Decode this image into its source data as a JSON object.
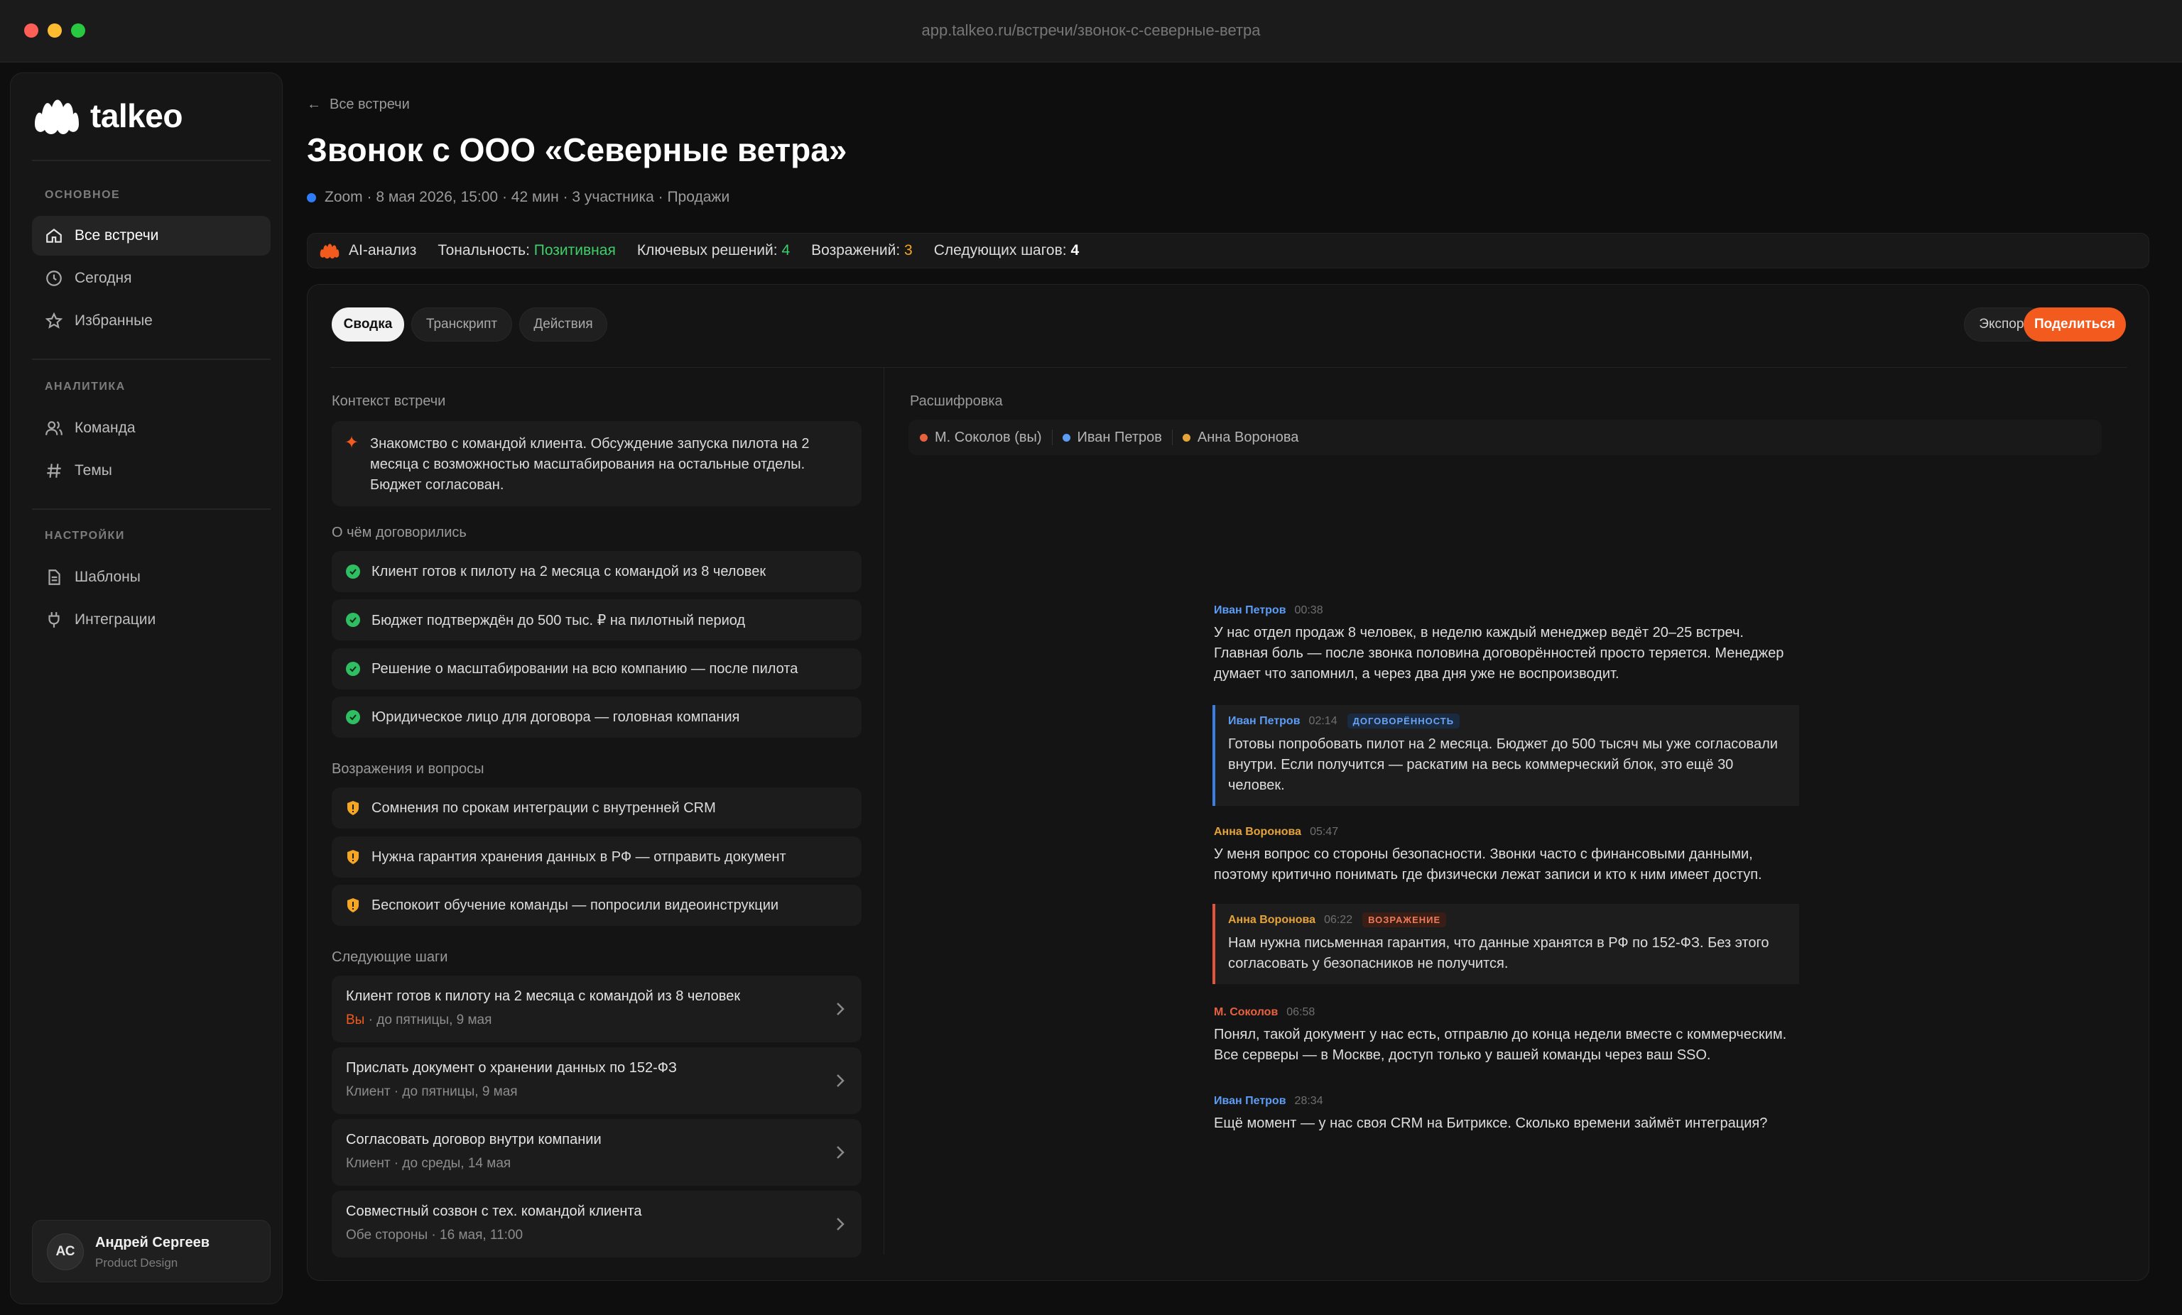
{
  "browser": {
    "url": "app.talkeo.ru/встречи/звонок-с-северные-ветра"
  },
  "brand": {
    "name": "talkeo",
    "accent": "#f35a1e"
  },
  "sidebar": {
    "sections": [
      {
        "label": "ОСНОВНОЕ",
        "items": [
          {
            "label": "Все встречи",
            "icon": "home-icon",
            "active": true
          },
          {
            "label": "Сегодня",
            "icon": "clock-icon"
          },
          {
            "label": "Избранные",
            "icon": "star-icon"
          }
        ]
      },
      {
        "label": "АНАЛИТИКА",
        "items": [
          {
            "label": "Команда",
            "icon": "users-icon"
          },
          {
            "label": "Темы",
            "icon": "hash-icon"
          }
        ]
      },
      {
        "label": "НАСТРОЙКИ",
        "items": [
          {
            "label": "Шаблоны",
            "icon": "document-icon"
          },
          {
            "label": "Интеграции",
            "icon": "plug-icon"
          }
        ]
      }
    ],
    "user": {
      "initials": "АС",
      "name": "Андрей Сергеев",
      "role": "Product Design"
    }
  },
  "header": {
    "back": "Все встречи",
    "title": "Звонок с ООО «Северные ветра»",
    "meta": "Zoom · 8 мая 2026, 15:00 · 42 мин · 3 участника · Продажи"
  },
  "ai_bar": {
    "label": "AI-анализ",
    "tone_label": "Тональность:",
    "tone_value": "Позитивная",
    "decisions_label": "Ключевых решений:",
    "decisions_value": "4",
    "objections_label": "Возражений:",
    "objections_value": "3",
    "steps_label": "Следующих шагов:",
    "steps_value": "4"
  },
  "tabs": [
    "Сводка",
    "Транскрипт",
    "Действия"
  ],
  "actions": {
    "export": "Экспорт",
    "share": "Поделиться"
  },
  "summary": {
    "context_title": "Контекст встречи",
    "context_text": "Знакомство с командой клиента. Обсуждение запуска пилота на 2 месяца с возможностью масштабирования на остальные отделы. Бюджет согласован.",
    "agreed_title": "О чём договорились",
    "agreed": [
      "Клиент готов к пилоту на 2 месяца с командой из 8 человек",
      "Бюджет подтверждён до 500 тыс. ₽ на пилотный период",
      "Решение о масштабировании на всю компанию — после пилота",
      "Юридическое лицо для договора — головная компания"
    ],
    "objections_title": "Возражения и вопросы",
    "objections": [
      "Сомнения по срокам интеграции с внутренней CRM",
      "Нужна гарантия хранения данных в РФ — отправить документ",
      "Беспокоит обучение команды — попросили видеоинструкции"
    ],
    "steps_title": "Следующие шаги",
    "steps": [
      {
        "title": "Клиент готов к пилоту на 2 месяца с командой из 8 человек",
        "owner": "Вы",
        "due": " · до пятницы, 9 мая"
      },
      {
        "title": "Прислать документ о хранении данных по 152-ФЗ",
        "owner": "Клиент",
        "due": " · до пятницы, 9 мая"
      },
      {
        "title": "Согласовать договор внутри компании",
        "owner": "Клиент",
        "due": " · до среды, 14 мая"
      },
      {
        "title": "Совместный созвон с тех. командой клиента",
        "owner": "Обе стороны",
        "due": " · 16 мая, 11:00"
      }
    ]
  },
  "transcript": {
    "title": "Расшифровка",
    "speakers": [
      {
        "name": "М. Соколов (вы)",
        "color": "#e7613f"
      },
      {
        "name": "Иван Петров",
        "color": "#5c9cf5"
      },
      {
        "name": "Анна Воронова",
        "color": "#e5a33a"
      }
    ],
    "messages": [
      {
        "name": "Иван Петров",
        "time": "00:38",
        "text": "У нас отдел продаж 8 человек, в неделю каждый менеджер ведёт 20–25 встреч. Главная боль — после звонка половина договорённостей просто теряется. Менеджер думает что запомнил, а через два дня уже не воспроизводит."
      },
      {
        "name": "Иван Петров",
        "time": "02:14",
        "tag": "ДОГОВОРЁННОСТЬ",
        "text": "Готовы попробовать пилот на 2 месяца. Бюджет до 500 тысяч мы уже согласовали внутри. Если получится — раскатим на весь коммерческий блок, это ещё 30 человек."
      },
      {
        "name": "Анна Воронова",
        "time": "05:47",
        "text": "У меня вопрос со стороны безопасности. Звонки часто с финансовыми данными, поэтому критично понимать где физически лежат записи и кто к ним имеет доступ."
      },
      {
        "name": "Анна Воронова",
        "time": "06:22",
        "tag": "ВОЗРАЖЕНИЕ",
        "text": "Нам нужна письменная гарантия, что данные хранятся в РФ по 152-ФЗ. Без этого согласовать у безопасников не получится."
      },
      {
        "name": "М. Соколов",
        "time": "06:58",
        "text": "Понял, такой документ у нас есть, отправлю до конца недели вместе с коммерческим. Все серверы — в Москве, доступ только у вашей команды через ваш SSO."
      },
      {
        "name": "Иван Петров",
        "time": "28:34",
        "text": "Ещё момент — у нас своя CRM на Битриксе. Сколько времени займёт интеграция?"
      }
    ]
  }
}
